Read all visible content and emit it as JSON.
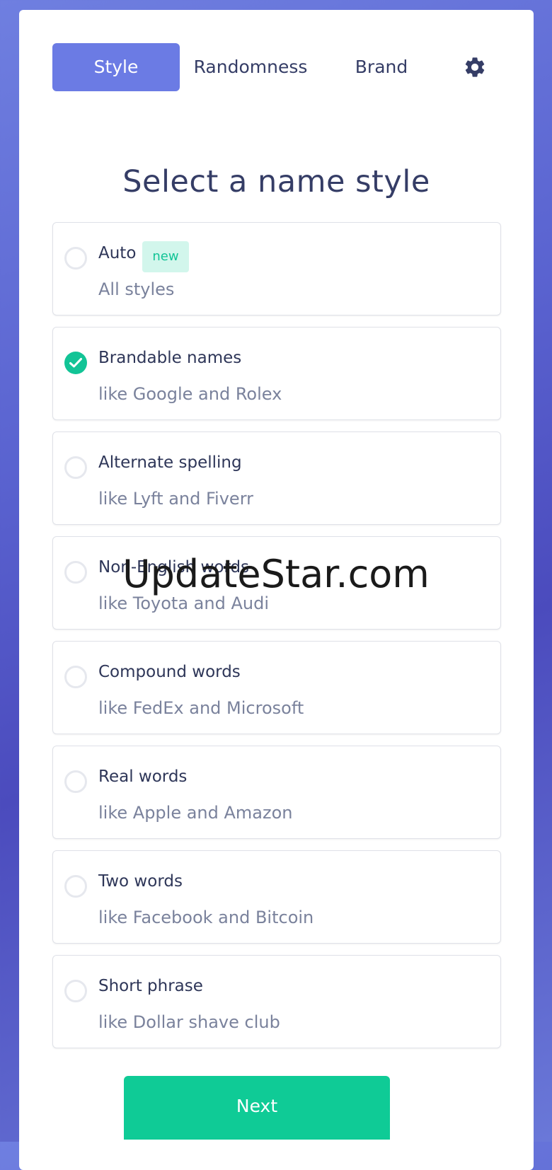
{
  "tabs": {
    "style_label": "Style",
    "randomness_label": "Randomness",
    "brand_label": "Brand",
    "settings_icon": "gear-icon"
  },
  "main": {
    "title": "Select a name style"
  },
  "options": [
    {
      "title": "Auto",
      "subtitle": "All styles",
      "badge": "new",
      "selected": false
    },
    {
      "title": "Brandable names",
      "subtitle": "like Google and Rolex",
      "selected": true
    },
    {
      "title": "Alternate spelling",
      "subtitle": "like Lyft and Fiverr",
      "selected": false
    },
    {
      "title": "Non-English words",
      "subtitle": "like Toyota and Audi",
      "selected": false
    },
    {
      "title": "Compound words",
      "subtitle": "like FedEx and Microsoft",
      "selected": false
    },
    {
      "title": "Real words",
      "subtitle": "like Apple and Amazon",
      "selected": false
    },
    {
      "title": "Two words",
      "subtitle": "like Facebook and Bitcoin",
      "selected": false
    },
    {
      "title": "Short phrase",
      "subtitle": "like Dollar shave club",
      "selected": false
    }
  ],
  "footer": {
    "next_label": "Next"
  },
  "watermark": "UpdateStar.com",
  "colors": {
    "accent": "#6b7be4",
    "success": "#12c496",
    "text": "#353d66"
  }
}
